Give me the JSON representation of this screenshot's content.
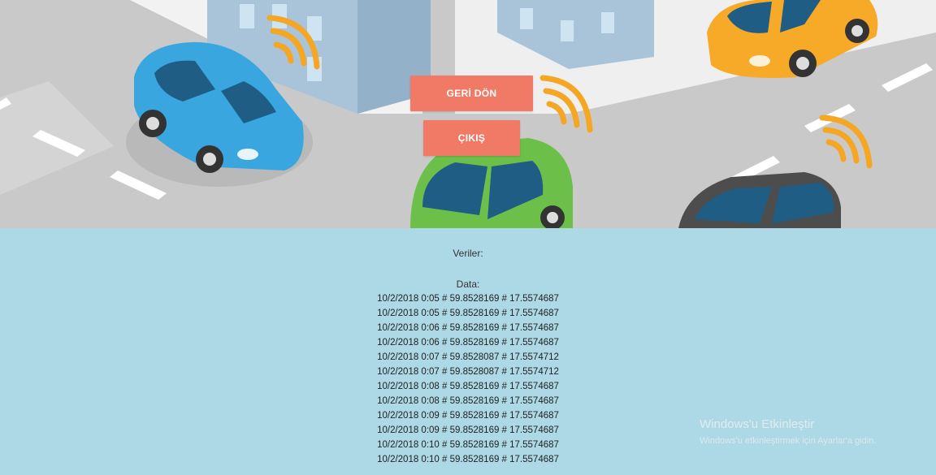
{
  "buttons": {
    "back_label": "GERİ DÖN",
    "exit_label": "ÇIKIŞ"
  },
  "data_section": {
    "title": "Veriler:",
    "data_label": "Data:",
    "rows": [
      "10/2/2018 0:05 # 59.8528169 # 17.5574687",
      "10/2/2018 0:05 # 59.8528169 # 17.5574687",
      "10/2/2018 0:06 # 59.8528169 # 17.5574687",
      "10/2/2018 0:06 # 59.8528169 # 17.5574687",
      "10/2/2018 0:07 # 59.8528087 # 17.5574712",
      "10/2/2018 0:07 # 59.8528087 # 17.5574712",
      "10/2/2018 0:08 # 59.8528169 # 17.5574687",
      "10/2/2018 0:08 # 59.8528169 # 17.5574687",
      "10/2/2018 0:09 # 59.8528169 # 17.5574687",
      "10/2/2018 0:09 # 59.8528169 # 17.5574687",
      "10/2/2018 0:10 # 59.8528169 # 17.5574687",
      "10/2/2018 0:10 # 59.8528169 # 17.5574687"
    ]
  },
  "watermark": {
    "title": "Windows'u Etkinleştir",
    "subtitle": "Windows'u etkinleştirmek için Ayarlar'a gidin."
  },
  "colors": {
    "button": "#f07a66",
    "panel": "#add8e6",
    "road": "#c9c9c9",
    "car_blue": "#3aa6e0",
    "car_green": "#6cc04a",
    "car_orange": "#f7a928",
    "car_gray": "#4d4d4d",
    "signal": "#f5a623"
  }
}
